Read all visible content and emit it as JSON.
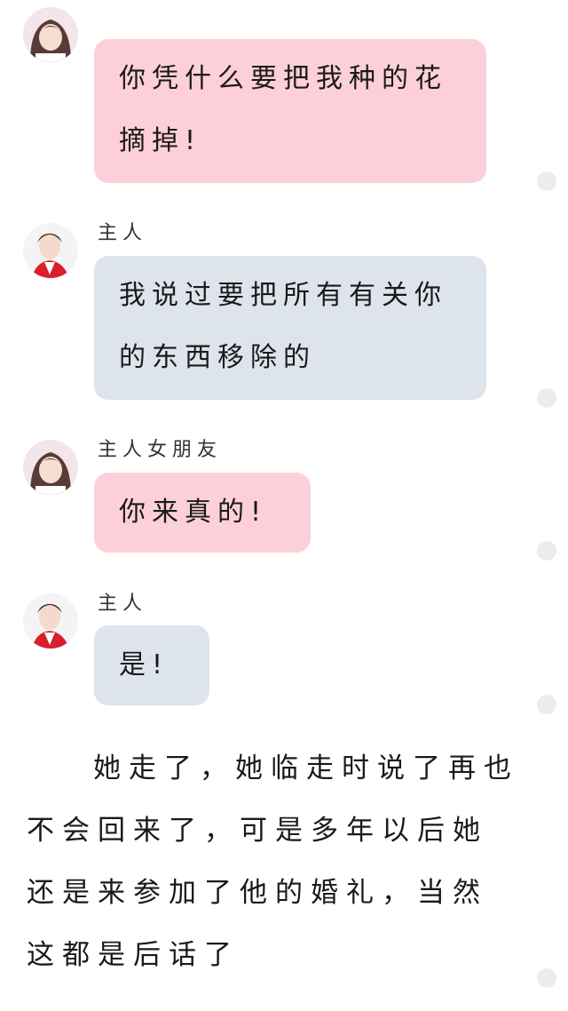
{
  "messages": [
    {
      "sender": "",
      "text": "你凭什么要把我种的花摘掉!",
      "side": "left",
      "bubble_color": "#fdd0d9",
      "avatar": "girlfriend-avatar"
    },
    {
      "sender": "主人",
      "text": "我说过要把所有有关你的东西移除的",
      "side": "left",
      "bubble_color": "#dde4ec",
      "avatar": "master-avatar"
    },
    {
      "sender": "主人女朋友",
      "text": "你来真的!",
      "side": "left",
      "bubble_color": "#fdd0d9",
      "avatar": "girlfriend-avatar"
    },
    {
      "sender": "主人",
      "text": "是!",
      "side": "left",
      "bubble_color": "#dde4ec",
      "avatar": "master-avatar"
    }
  ],
  "narration": "她走了，她临走时说了再也不会回来了，可是多年以后她还是来参加了他的婚礼，当然这都是后话了",
  "colors": {
    "pink_bubble": "#fdd0d9",
    "blue_bubble": "#dde4ec",
    "side_dot": "#ececec"
  }
}
